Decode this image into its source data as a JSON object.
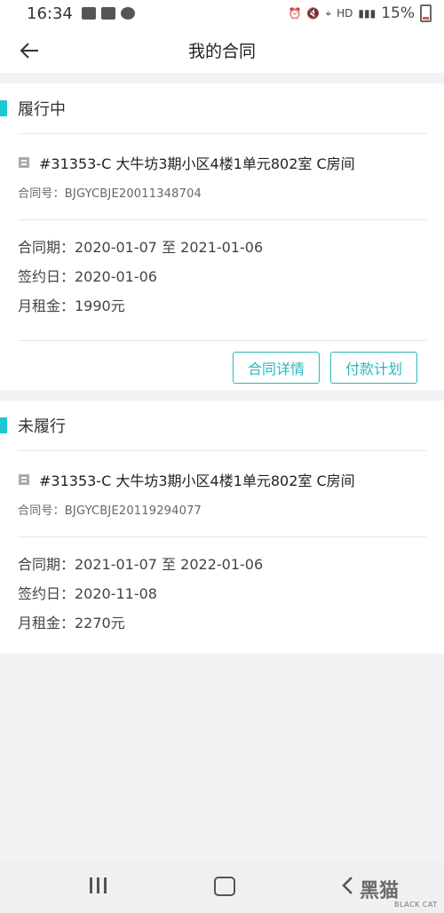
{
  "status_bar": {
    "time": "16:34",
    "network": "HD",
    "battery": "15%"
  },
  "header": {
    "title": "我的合同"
  },
  "sections": [
    {
      "title": "履行中",
      "address": "#31353-C 大牛坊3期小区4楼1单元802室 C房间",
      "contract_no": "合同号：BJGYCBJE20011348704",
      "period": "合同期：2020-01-07 至 2021-01-06",
      "sign_date": "签约日：2020-01-06",
      "rent": "月租金：1990元",
      "buttons": {
        "details": "合同详情",
        "payment": "付款计划"
      }
    },
    {
      "title": "未履行",
      "address": "#31353-C 大牛坊3期小区4楼1单元802室 C房间",
      "contract_no": "合同号：BJGYCBJE20119294077",
      "period": "合同期：2021-01-07 至 2022-01-06",
      "sign_date": "签约日：2020-11-08",
      "rent": "月租金：2270元"
    }
  ],
  "watermark": {
    "text": "黑猫",
    "sub": "BLACK CAT"
  },
  "colors": {
    "accent": "#1ec8d0",
    "button": "#2ab7bd"
  }
}
